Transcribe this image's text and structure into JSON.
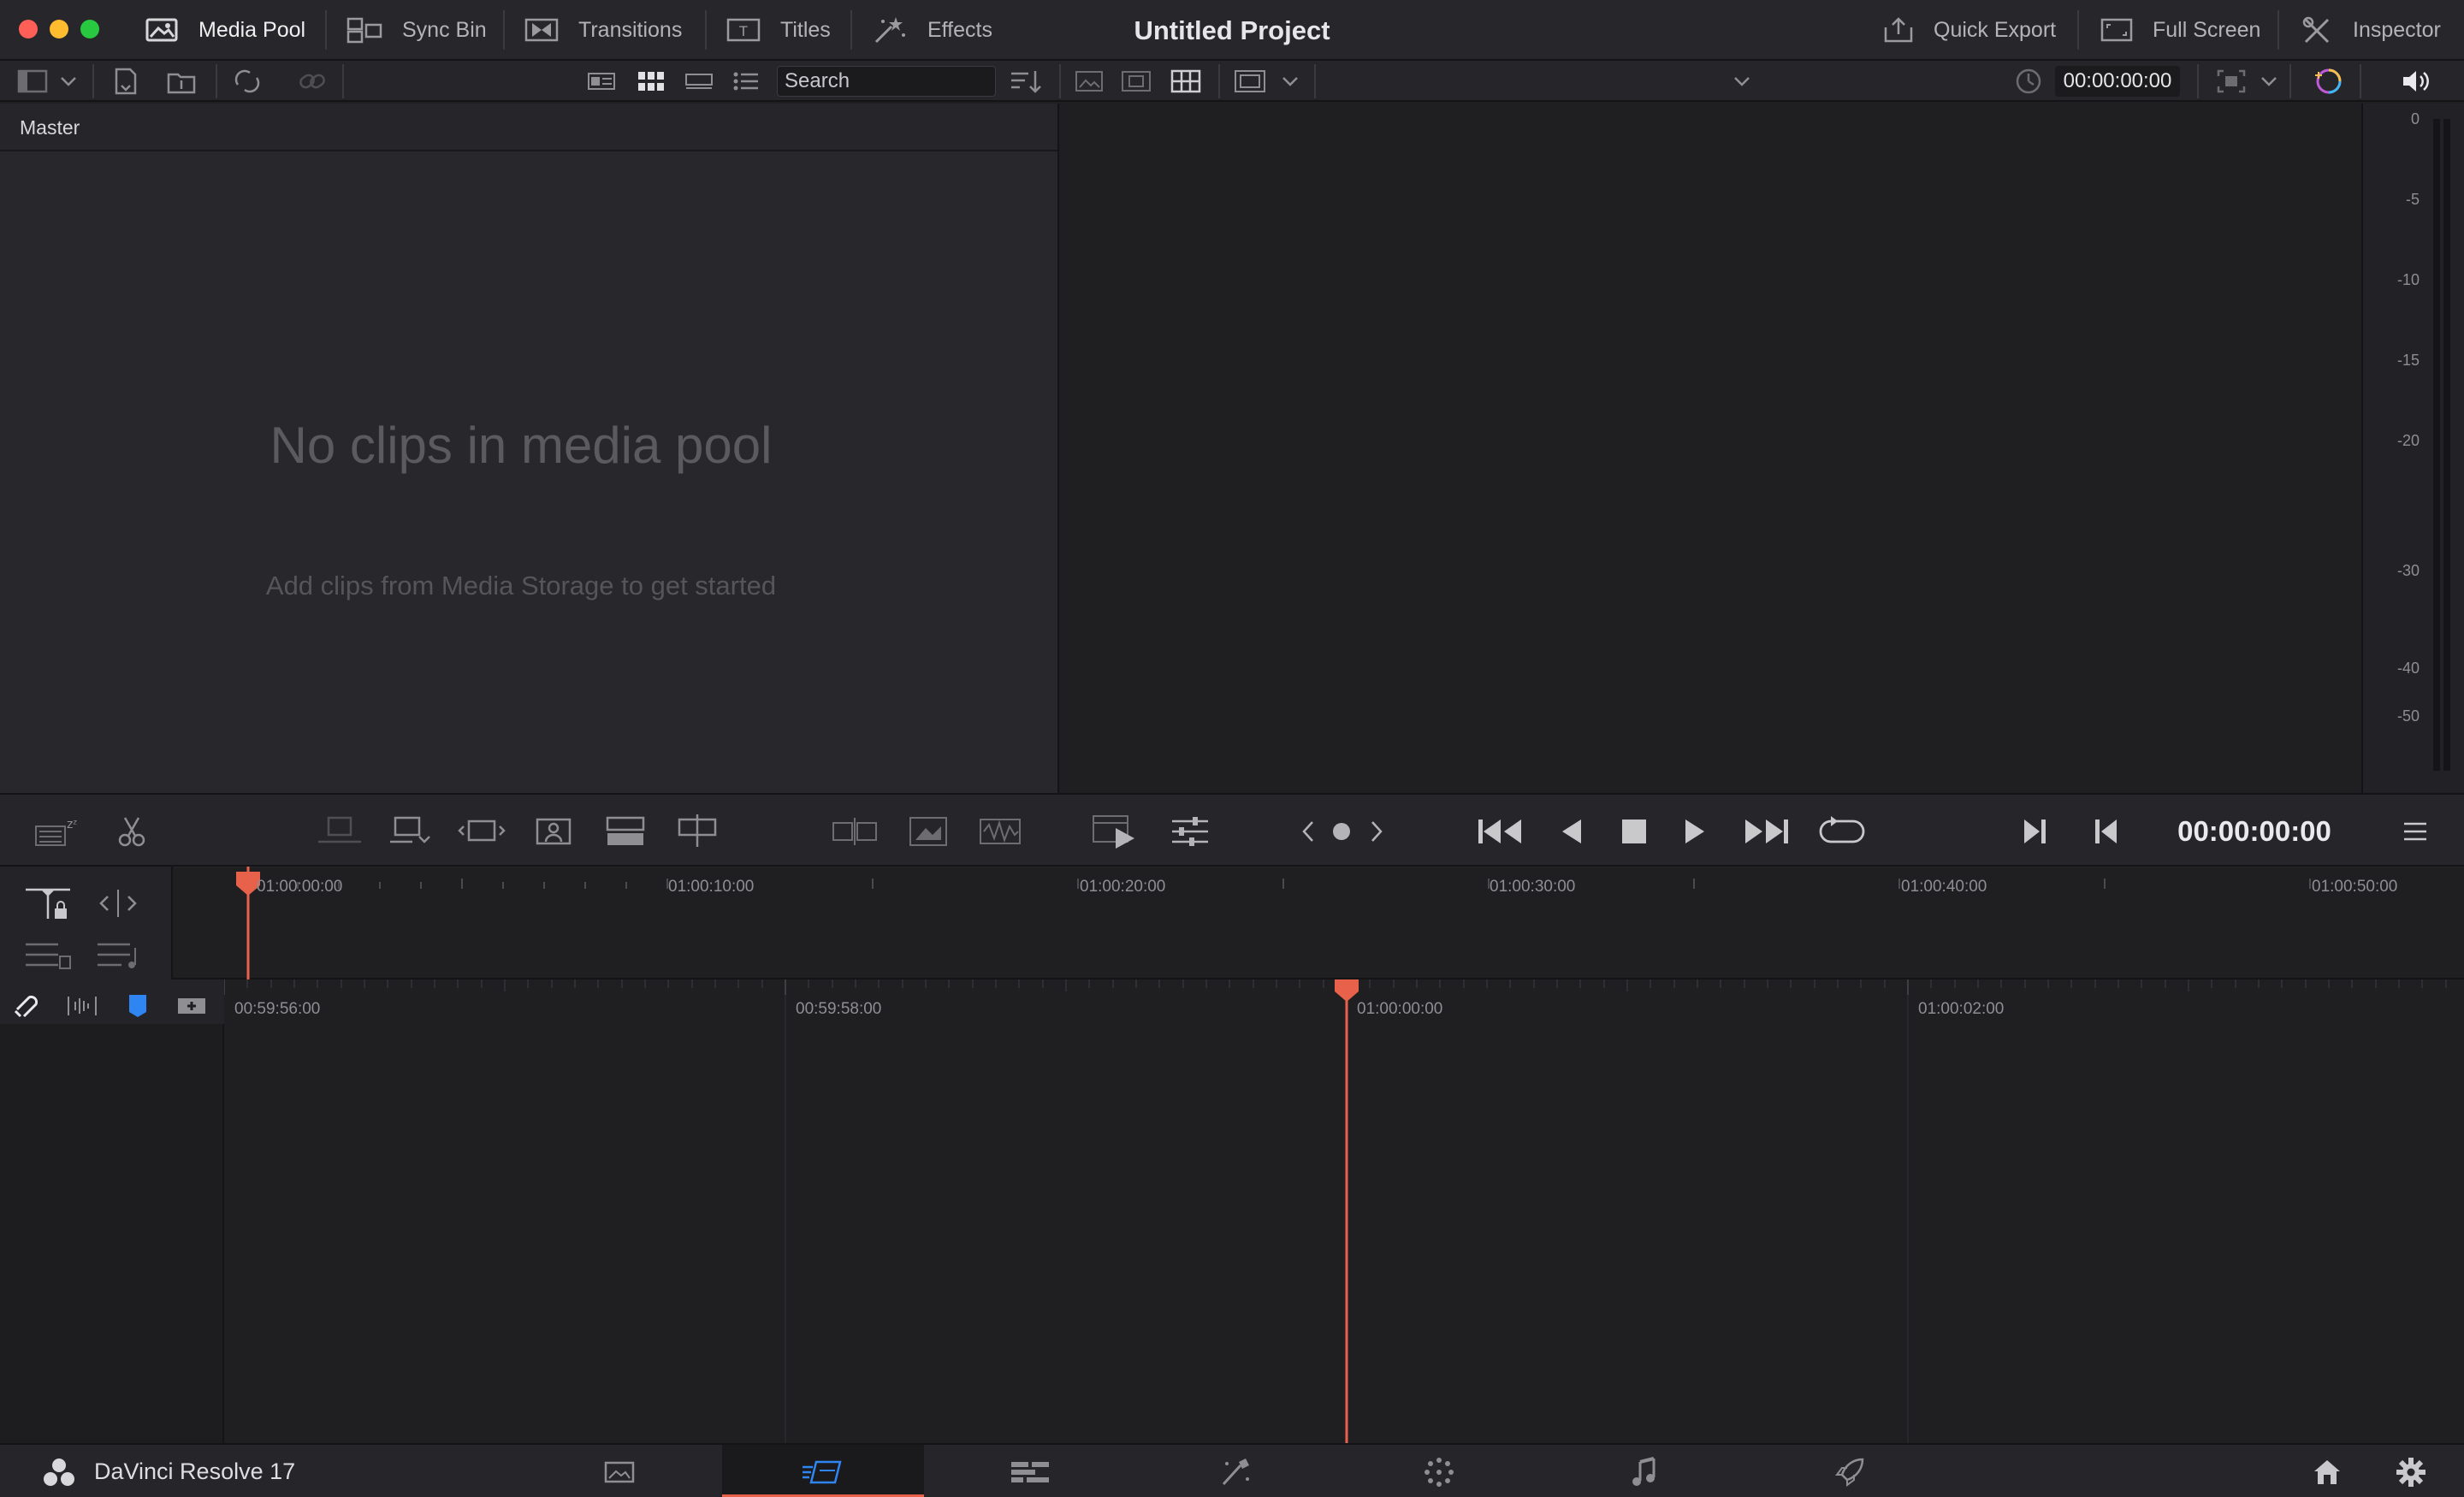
{
  "window": {
    "project_title": "Untitled Project"
  },
  "toolbar_left": [
    {
      "label": "Media Pool",
      "icon": "media-pool-icon",
      "active": true
    },
    {
      "label": "Sync Bin",
      "icon": "sync-bin-icon",
      "active": false
    },
    {
      "label": "Transitions",
      "icon": "transitions-icon",
      "active": false
    },
    {
      "label": "Titles",
      "icon": "titles-icon",
      "active": false
    },
    {
      "label": "Effects",
      "icon": "effects-icon",
      "active": false
    }
  ],
  "toolbar_right": [
    {
      "label": "Quick Export",
      "icon": "quick-export-icon"
    },
    {
      "label": "Full Screen",
      "icon": "full-screen-icon"
    },
    {
      "label": "Inspector",
      "icon": "inspector-icon"
    }
  ],
  "media_pool": {
    "bin_name": "Master",
    "search_placeholder": "Search",
    "empty_title": "No clips in media pool",
    "empty_subtitle": "Add clips from Media Storage to get started"
  },
  "viewer": {
    "source_timecode": "00:00:00:00",
    "main_timecode": "00:00:00:00"
  },
  "audio_meter": {
    "scale": [
      "0",
      "-5",
      "-10",
      "-15",
      "-20",
      "-30",
      "-40",
      "-50"
    ]
  },
  "upper_timeline": {
    "ruler": [
      "01:00:00:00",
      "01:00:10:00",
      "01:00:20:00",
      "01:00:30:00",
      "01:00:40:00",
      "01:00:50:00"
    ]
  },
  "lower_timeline": {
    "ruler": [
      "00:59:56:00",
      "00:59:58:00",
      "01:00:00:00",
      "01:00:02:00"
    ]
  },
  "pagebar": {
    "app_name": "DaVinci Resolve 17",
    "pages": [
      "media-page-icon",
      "cut-page-icon",
      "edit-page-icon",
      "fusion-page-icon",
      "color-page-icon",
      "fairlight-page-icon",
      "deliver-page-icon"
    ],
    "active_page": "cut-page-icon"
  },
  "colors": {
    "accent_playhead": "#e8624b",
    "marker_blue": "#2f86f2"
  }
}
